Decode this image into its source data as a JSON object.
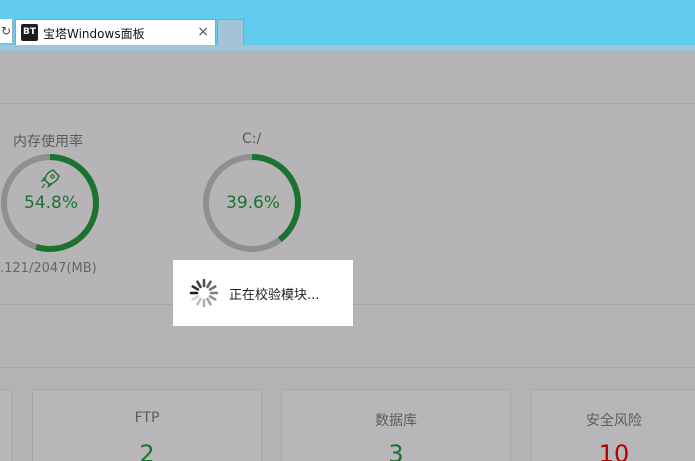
{
  "browser": {
    "refresh_glyph": "↻",
    "tab": {
      "favicon_text": "BT",
      "title": "宝塔Windows面板",
      "close_glyph": "×"
    }
  },
  "gauges": [
    {
      "title": "内存使用率",
      "value_text": "54.8%",
      "percent": 54.8,
      "sub_text": ".121/2047(MB)",
      "icon": "rocket-icon"
    },
    {
      "title": "C:/",
      "value_text": "39.6%",
      "percent": 39.6
    }
  ],
  "stats": [
    {
      "label": "FTP",
      "value": "2",
      "color": "#1a7430"
    },
    {
      "label": "数据库",
      "value": "3",
      "color": "#1a7430"
    },
    {
      "label": "安全风险",
      "value": "10",
      "color": "#b20000"
    }
  ],
  "loading": {
    "text": "正在校验模块..."
  },
  "colors": {
    "browser_bar": "#62ccef",
    "gauge_fill": "#1a7430",
    "gauge_track": "#8f8f8f",
    "overlay": "#b4b2b5"
  }
}
